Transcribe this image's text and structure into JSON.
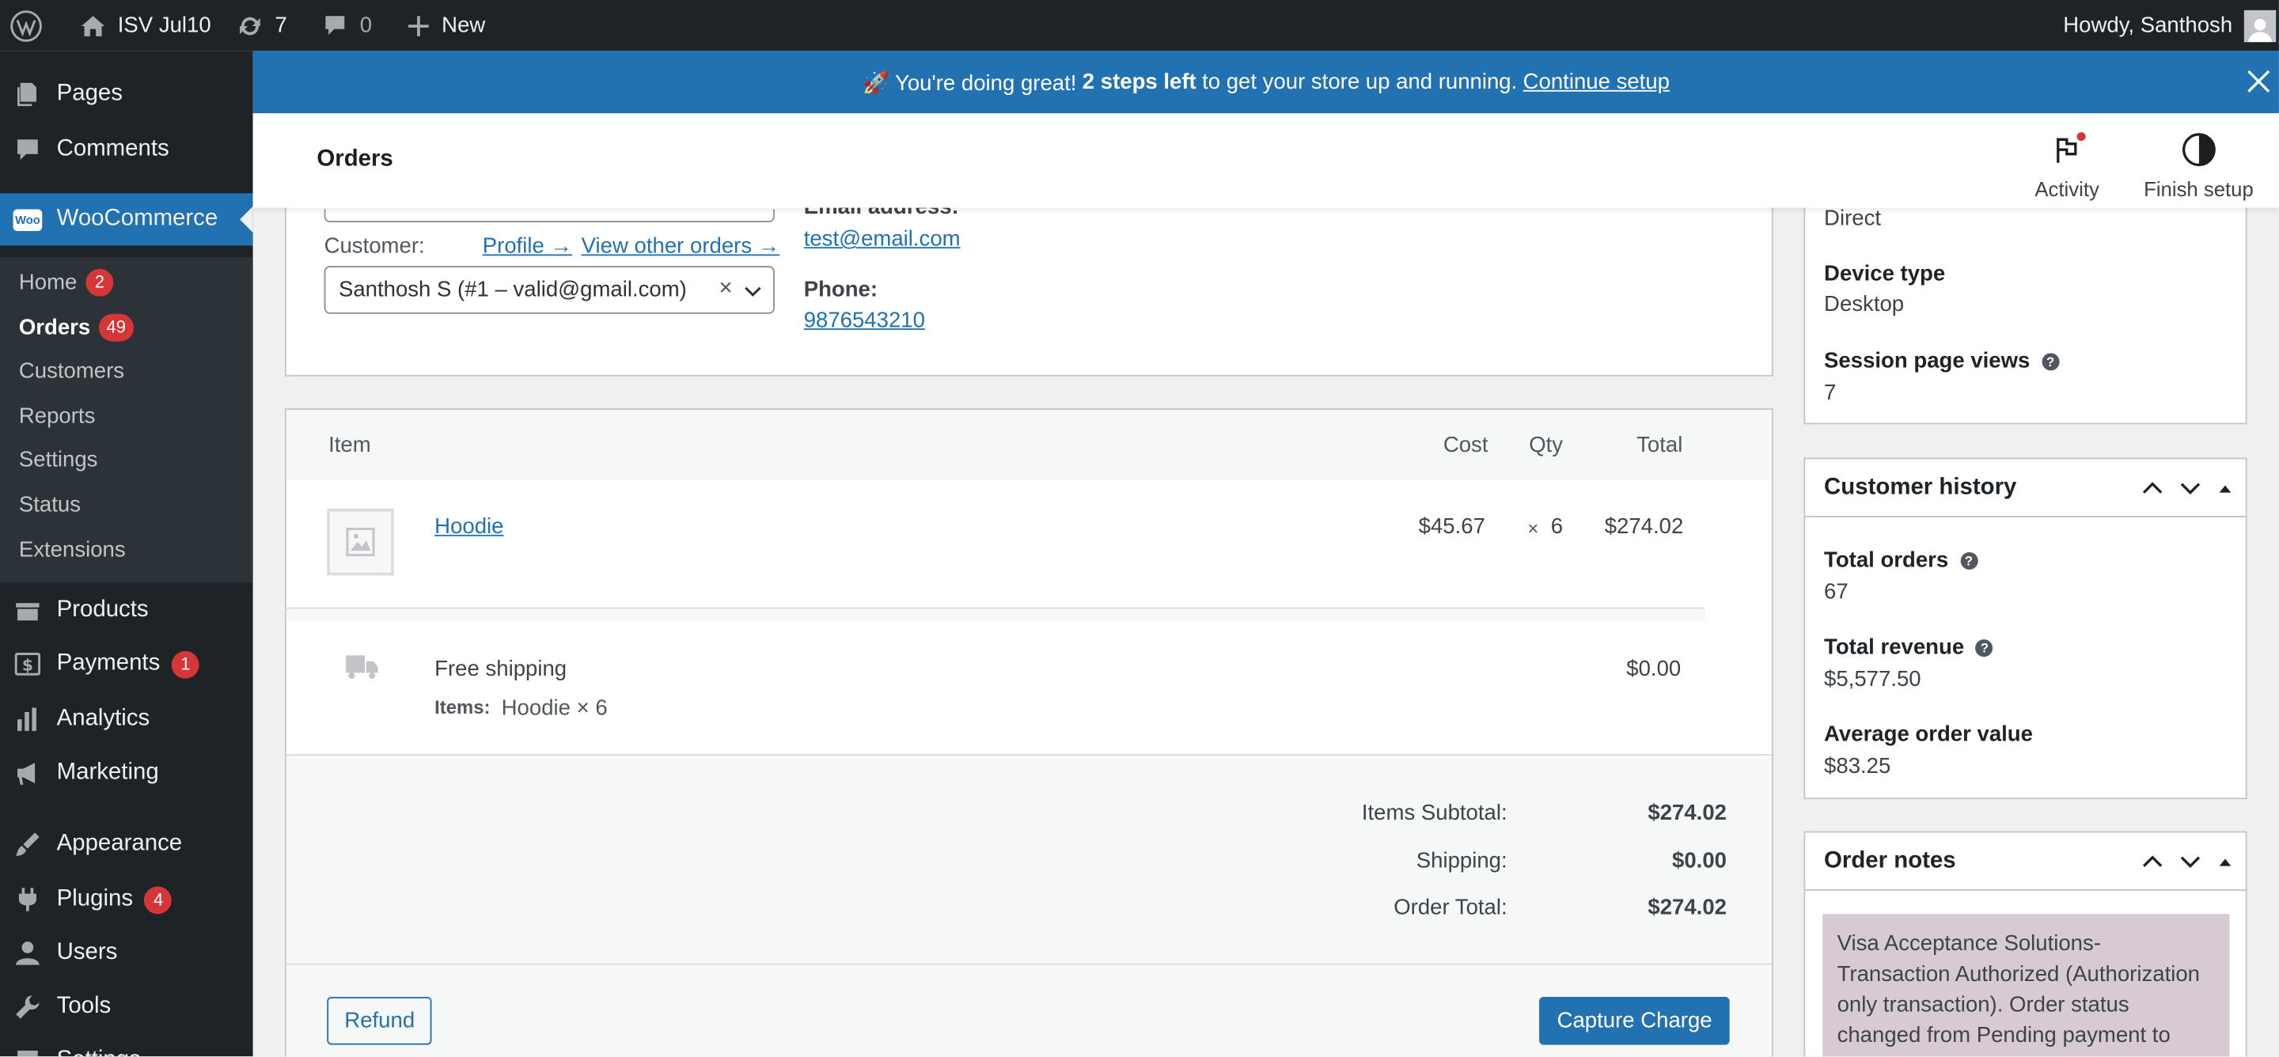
{
  "admin_bar": {
    "site_name": "ISV Jul10",
    "updates_count": "7",
    "comments_count": "0",
    "new_label": "New",
    "howdy": "Howdy, Santhosh"
  },
  "sidebar": {
    "items_top": [
      {
        "label": "Pages",
        "icon": "pages-icon"
      },
      {
        "label": "Comments",
        "icon": "comments-icon"
      },
      {
        "label": "WooCommerce",
        "icon": "woocommerce-icon"
      }
    ],
    "wc_logo_text": "Woo",
    "submenu": [
      {
        "label": "Home",
        "badge": "2"
      },
      {
        "label": "Orders",
        "badge": "49"
      },
      {
        "label": "Customers",
        "badge": ""
      },
      {
        "label": "Reports",
        "badge": ""
      },
      {
        "label": "Settings",
        "badge": ""
      },
      {
        "label": "Status",
        "badge": ""
      },
      {
        "label": "Extensions",
        "badge": ""
      }
    ],
    "items_bottom": [
      {
        "label": "Products",
        "badge": ""
      },
      {
        "label": "Payments",
        "badge": "1"
      },
      {
        "label": "Analytics",
        "badge": ""
      },
      {
        "label": "Marketing",
        "badge": ""
      },
      {
        "label": "Appearance",
        "badge": ""
      },
      {
        "label": "Plugins",
        "badge": "4"
      },
      {
        "label": "Users",
        "badge": ""
      },
      {
        "label": "Tools",
        "badge": ""
      },
      {
        "label": "Settings",
        "badge": ""
      }
    ]
  },
  "notice": {
    "prefix": "🚀 You're doing great!",
    "bold": "2 steps left",
    "suffix": "to get your store up and running.",
    "link": "Continue setup"
  },
  "header": {
    "title": "Orders",
    "activity_label": "Activity",
    "finish_setup_label": "Finish setup"
  },
  "customer": {
    "customer_label": "Customer:",
    "profile_link": "Profile →",
    "view_orders_link": "View other orders →",
    "selected_customer": "Santhosh S (#1 – valid@gmail.com)",
    "email_label": "Email address:",
    "email_value": "test@email.com",
    "phone_label": "Phone:",
    "phone_value": "9876543210"
  },
  "items": {
    "headers": {
      "item": "Item",
      "cost": "Cost",
      "qty": "Qty",
      "total": "Total"
    },
    "line": {
      "name": "Hoodie",
      "cost": "$45.67",
      "qty_symbol": "×",
      "qty": "6",
      "total": "$274.02"
    },
    "shipping": {
      "name": "Free shipping",
      "items_label": "Items:",
      "items_value": "Hoodie × 6",
      "total": "$0.00"
    },
    "totals": [
      {
        "label": "Items Subtotal:",
        "value": "$274.02"
      },
      {
        "label": "Shipping:",
        "value": "$0.00"
      },
      {
        "label": "Order Total:",
        "value": "$274.02"
      }
    ],
    "refund_label": "Refund",
    "capture_label": "Capture Charge"
  },
  "attribution": {
    "origin_value": "Direct",
    "device_label": "Device type",
    "device_value": "Desktop",
    "views_label": "Session page views",
    "views_value": "7"
  },
  "customer_history": {
    "title": "Customer history",
    "total_orders_label": "Total orders",
    "total_orders_value": "67",
    "total_revenue_label": "Total revenue",
    "total_revenue_value": "$5,577.50",
    "aov_label": "Average order value",
    "aov_value": "$83.25"
  },
  "order_notes": {
    "title": "Order notes",
    "note_text": "Visa Acceptance Solutions- Transaction Authorized (Authorization only transaction). Order status changed from Pending payment to"
  },
  "colors": {
    "admin_bar": "#1d2327",
    "accent": "#2271b1",
    "badge": "#d63638",
    "note_bg": "#d7cad2"
  }
}
